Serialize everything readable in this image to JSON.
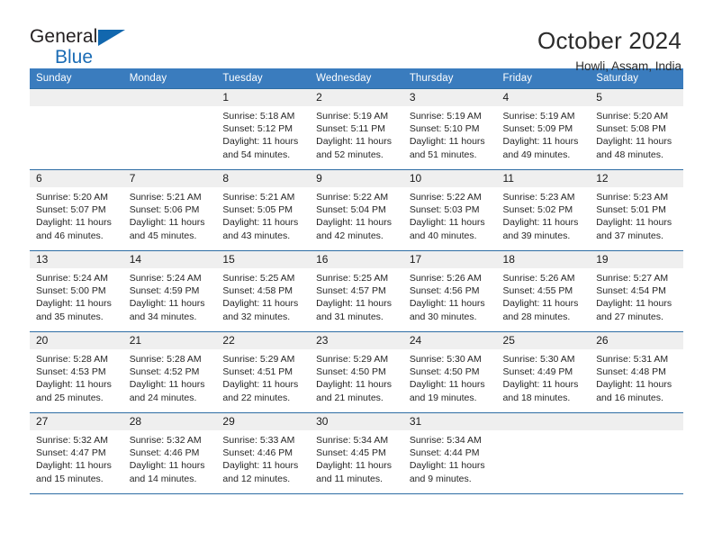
{
  "brand": {
    "name_part1": "General",
    "name_part2": "Blue",
    "accent_color": "#1267ae"
  },
  "header": {
    "title": "October 2024",
    "subtitle": "Howli, Assam, India"
  },
  "calendar": {
    "header_bg": "#3a7cbe",
    "row_border_color": "#2e6da4",
    "daynum_band_bg": "#efefef",
    "weekdays": [
      "Sunday",
      "Monday",
      "Tuesday",
      "Wednesday",
      "Thursday",
      "Friday",
      "Saturday"
    ],
    "weeks": [
      [
        {
          "day": "",
          "empty": true,
          "sunrise": "",
          "sunset": "",
          "daylight_line1": "",
          "daylight_line2": ""
        },
        {
          "day": "",
          "empty": true,
          "sunrise": "",
          "sunset": "",
          "daylight_line1": "",
          "daylight_line2": ""
        },
        {
          "day": "1",
          "sunrise": "Sunrise: 5:18 AM",
          "sunset": "Sunset: 5:12 PM",
          "daylight_line1": "Daylight: 11 hours",
          "daylight_line2": "and 54 minutes."
        },
        {
          "day": "2",
          "sunrise": "Sunrise: 5:19 AM",
          "sunset": "Sunset: 5:11 PM",
          "daylight_line1": "Daylight: 11 hours",
          "daylight_line2": "and 52 minutes."
        },
        {
          "day": "3",
          "sunrise": "Sunrise: 5:19 AM",
          "sunset": "Sunset: 5:10 PM",
          "daylight_line1": "Daylight: 11 hours",
          "daylight_line2": "and 51 minutes."
        },
        {
          "day": "4",
          "sunrise": "Sunrise: 5:19 AM",
          "sunset": "Sunset: 5:09 PM",
          "daylight_line1": "Daylight: 11 hours",
          "daylight_line2": "and 49 minutes."
        },
        {
          "day": "5",
          "sunrise": "Sunrise: 5:20 AM",
          "sunset": "Sunset: 5:08 PM",
          "daylight_line1": "Daylight: 11 hours",
          "daylight_line2": "and 48 minutes."
        }
      ],
      [
        {
          "day": "6",
          "sunrise": "Sunrise: 5:20 AM",
          "sunset": "Sunset: 5:07 PM",
          "daylight_line1": "Daylight: 11 hours",
          "daylight_line2": "and 46 minutes."
        },
        {
          "day": "7",
          "sunrise": "Sunrise: 5:21 AM",
          "sunset": "Sunset: 5:06 PM",
          "daylight_line1": "Daylight: 11 hours",
          "daylight_line2": "and 45 minutes."
        },
        {
          "day": "8",
          "sunrise": "Sunrise: 5:21 AM",
          "sunset": "Sunset: 5:05 PM",
          "daylight_line1": "Daylight: 11 hours",
          "daylight_line2": "and 43 minutes."
        },
        {
          "day": "9",
          "sunrise": "Sunrise: 5:22 AM",
          "sunset": "Sunset: 5:04 PM",
          "daylight_line1": "Daylight: 11 hours",
          "daylight_line2": "and 42 minutes."
        },
        {
          "day": "10",
          "sunrise": "Sunrise: 5:22 AM",
          "sunset": "Sunset: 5:03 PM",
          "daylight_line1": "Daylight: 11 hours",
          "daylight_line2": "and 40 minutes."
        },
        {
          "day": "11",
          "sunrise": "Sunrise: 5:23 AM",
          "sunset": "Sunset: 5:02 PM",
          "daylight_line1": "Daylight: 11 hours",
          "daylight_line2": "and 39 minutes."
        },
        {
          "day": "12",
          "sunrise": "Sunrise: 5:23 AM",
          "sunset": "Sunset: 5:01 PM",
          "daylight_line1": "Daylight: 11 hours",
          "daylight_line2": "and 37 minutes."
        }
      ],
      [
        {
          "day": "13",
          "sunrise": "Sunrise: 5:24 AM",
          "sunset": "Sunset: 5:00 PM",
          "daylight_line1": "Daylight: 11 hours",
          "daylight_line2": "and 35 minutes."
        },
        {
          "day": "14",
          "sunrise": "Sunrise: 5:24 AM",
          "sunset": "Sunset: 4:59 PM",
          "daylight_line1": "Daylight: 11 hours",
          "daylight_line2": "and 34 minutes."
        },
        {
          "day": "15",
          "sunrise": "Sunrise: 5:25 AM",
          "sunset": "Sunset: 4:58 PM",
          "daylight_line1": "Daylight: 11 hours",
          "daylight_line2": "and 32 minutes."
        },
        {
          "day": "16",
          "sunrise": "Sunrise: 5:25 AM",
          "sunset": "Sunset: 4:57 PM",
          "daylight_line1": "Daylight: 11 hours",
          "daylight_line2": "and 31 minutes."
        },
        {
          "day": "17",
          "sunrise": "Sunrise: 5:26 AM",
          "sunset": "Sunset: 4:56 PM",
          "daylight_line1": "Daylight: 11 hours",
          "daylight_line2": "and 30 minutes."
        },
        {
          "day": "18",
          "sunrise": "Sunrise: 5:26 AM",
          "sunset": "Sunset: 4:55 PM",
          "daylight_line1": "Daylight: 11 hours",
          "daylight_line2": "and 28 minutes."
        },
        {
          "day": "19",
          "sunrise": "Sunrise: 5:27 AM",
          "sunset": "Sunset: 4:54 PM",
          "daylight_line1": "Daylight: 11 hours",
          "daylight_line2": "and 27 minutes."
        }
      ],
      [
        {
          "day": "20",
          "sunrise": "Sunrise: 5:28 AM",
          "sunset": "Sunset: 4:53 PM",
          "daylight_line1": "Daylight: 11 hours",
          "daylight_line2": "and 25 minutes."
        },
        {
          "day": "21",
          "sunrise": "Sunrise: 5:28 AM",
          "sunset": "Sunset: 4:52 PM",
          "daylight_line1": "Daylight: 11 hours",
          "daylight_line2": "and 24 minutes."
        },
        {
          "day": "22",
          "sunrise": "Sunrise: 5:29 AM",
          "sunset": "Sunset: 4:51 PM",
          "daylight_line1": "Daylight: 11 hours",
          "daylight_line2": "and 22 minutes."
        },
        {
          "day": "23",
          "sunrise": "Sunrise: 5:29 AM",
          "sunset": "Sunset: 4:50 PM",
          "daylight_line1": "Daylight: 11 hours",
          "daylight_line2": "and 21 minutes."
        },
        {
          "day": "24",
          "sunrise": "Sunrise: 5:30 AM",
          "sunset": "Sunset: 4:50 PM",
          "daylight_line1": "Daylight: 11 hours",
          "daylight_line2": "and 19 minutes."
        },
        {
          "day": "25",
          "sunrise": "Sunrise: 5:30 AM",
          "sunset": "Sunset: 4:49 PM",
          "daylight_line1": "Daylight: 11 hours",
          "daylight_line2": "and 18 minutes."
        },
        {
          "day": "26",
          "sunrise": "Sunrise: 5:31 AM",
          "sunset": "Sunset: 4:48 PM",
          "daylight_line1": "Daylight: 11 hours",
          "daylight_line2": "and 16 minutes."
        }
      ],
      [
        {
          "day": "27",
          "sunrise": "Sunrise: 5:32 AM",
          "sunset": "Sunset: 4:47 PM",
          "daylight_line1": "Daylight: 11 hours",
          "daylight_line2": "and 15 minutes."
        },
        {
          "day": "28",
          "sunrise": "Sunrise: 5:32 AM",
          "sunset": "Sunset: 4:46 PM",
          "daylight_line1": "Daylight: 11 hours",
          "daylight_line2": "and 14 minutes."
        },
        {
          "day": "29",
          "sunrise": "Sunrise: 5:33 AM",
          "sunset": "Sunset: 4:46 PM",
          "daylight_line1": "Daylight: 11 hours",
          "daylight_line2": "and 12 minutes."
        },
        {
          "day": "30",
          "sunrise": "Sunrise: 5:34 AM",
          "sunset": "Sunset: 4:45 PM",
          "daylight_line1": "Daylight: 11 hours",
          "daylight_line2": "and 11 minutes."
        },
        {
          "day": "31",
          "sunrise": "Sunrise: 5:34 AM",
          "sunset": "Sunset: 4:44 PM",
          "daylight_line1": "Daylight: 11 hours",
          "daylight_line2": "and 9 minutes."
        },
        {
          "day": "",
          "empty": true,
          "sunrise": "",
          "sunset": "",
          "daylight_line1": "",
          "daylight_line2": ""
        },
        {
          "day": "",
          "empty": true,
          "sunrise": "",
          "sunset": "",
          "daylight_line1": "",
          "daylight_line2": ""
        }
      ]
    ]
  }
}
